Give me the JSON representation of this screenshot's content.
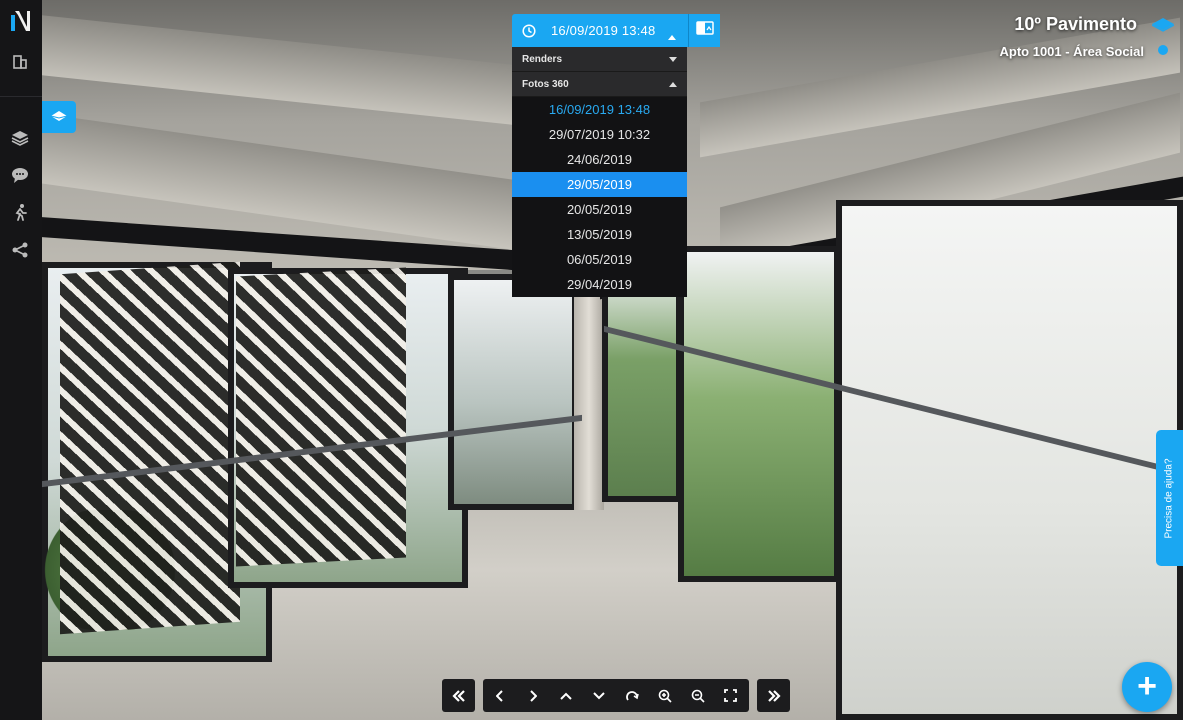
{
  "header": {
    "date_selector": {
      "current_label": "16/09/2019 13:48",
      "clock_icon": "clock-icon",
      "caret_icon": "caret-up-icon"
    },
    "compare_button": {
      "icon": "compare-split-icon"
    }
  },
  "dropdown": {
    "sections": [
      {
        "label": "Renders",
        "expanded": false
      },
      {
        "label": "Fotos 360",
        "expanded": true
      }
    ],
    "dates": [
      {
        "label": "16/09/2019 13:48",
        "state": "current"
      },
      {
        "label": "29/07/2019 10:32",
        "state": ""
      },
      {
        "label": "24/06/2019",
        "state": ""
      },
      {
        "label": "29/05/2019",
        "state": "selected"
      },
      {
        "label": "20/05/2019",
        "state": ""
      },
      {
        "label": "13/05/2019",
        "state": ""
      },
      {
        "label": "06/05/2019",
        "state": ""
      },
      {
        "label": "29/04/2019",
        "state": ""
      }
    ]
  },
  "location": {
    "floor": "10º Pavimento",
    "unit": "Apto 1001 - Área Social"
  },
  "sidebar": {
    "logo": "logo-icon",
    "items": [
      {
        "name": "building-icon"
      },
      {
        "name": "layers-icon"
      },
      {
        "name": "comments-icon"
      },
      {
        "name": "walk-icon"
      },
      {
        "name": "share-icon"
      }
    ]
  },
  "help": {
    "label": "Precisa de ajuda?"
  },
  "fab": {
    "label": "+"
  },
  "bottom_nav": {
    "prev_group": "double-left-icon",
    "controls": [
      "chevron-left-icon",
      "chevron-right-icon",
      "chevron-up-icon",
      "chevron-down-icon",
      "rotate-icon",
      "zoom-in-icon",
      "zoom-out-icon",
      "fullscreen-icon"
    ],
    "next_group": "double-right-icon"
  },
  "colors": {
    "accent": "#1aa7f2",
    "sidebar_bg": "#151517",
    "dropdown_bg": "#121214",
    "current_date": "#29a9f0",
    "selected_date_bg": "#1a8ff0"
  }
}
